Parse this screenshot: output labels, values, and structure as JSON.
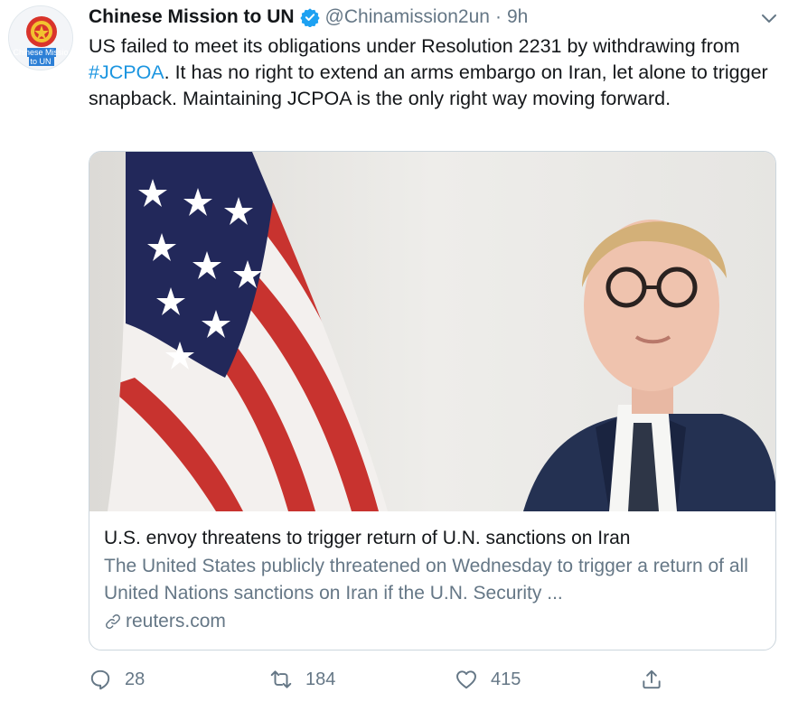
{
  "account": {
    "avatar_text": "Chinese Mission to UN",
    "avatar_line1": "Chinese Missio",
    "avatar_line2": "to UN",
    "name": "Chinese Mission to UN",
    "handle": "@Chinamission2un",
    "separator": "·",
    "time": "9h"
  },
  "tweet": {
    "text_before": "US failed to meet its obligations under Resolution 2231 by withdrawing from ",
    "hashtag": "#JCPOA",
    "text_after": ". It has no right to extend an arms embargo on Iran, let alone to trigger snapback. Maintaining JCPOA is the only right way moving forward."
  },
  "card": {
    "title": "U.S. envoy threatens to trigger return of U.N. sanctions on Iran",
    "description": "The United States publicly threatened on Wednesday to trigger a return of all United Nations sanctions on Iran if the U.N. Security ...",
    "domain": "reuters.com"
  },
  "actions": {
    "replies": "28",
    "retweets": "184",
    "likes": "415"
  },
  "colors": {
    "link": "#1b95e0",
    "secondary": "#657786",
    "verified": "#1da1f2"
  },
  "icons": [
    "avatar-emblem-icon",
    "verified-badge-icon",
    "chevron-down-icon",
    "link-icon",
    "reply-icon",
    "retweet-icon",
    "like-icon",
    "share-icon"
  ]
}
